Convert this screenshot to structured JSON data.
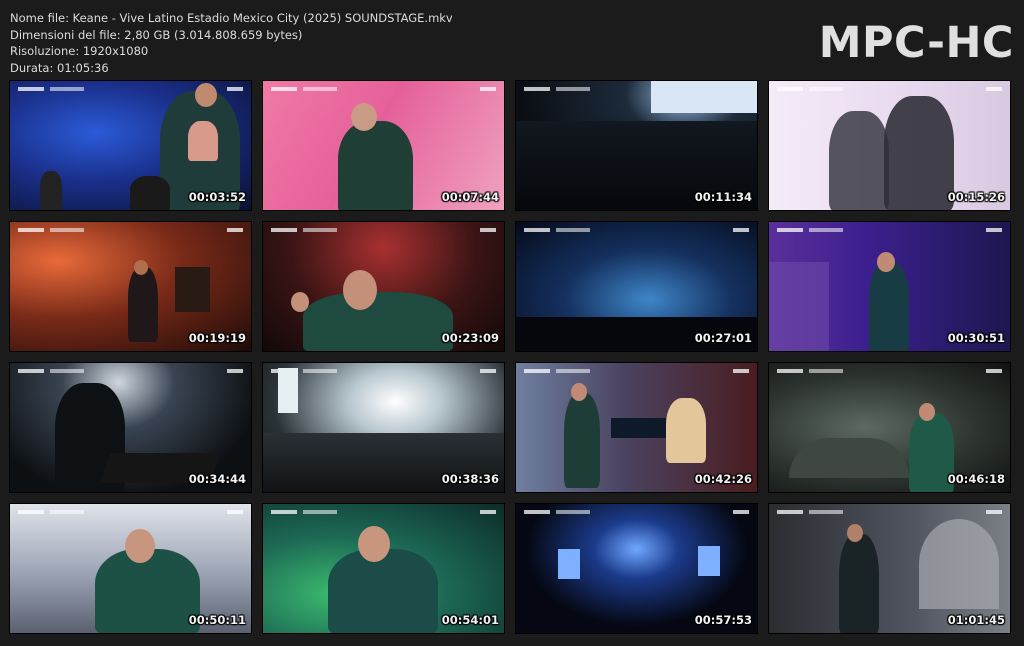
{
  "info": {
    "filename_line": "Nome file: Keane - Vive Latino Estadio Mexico City (2025) SOUNDSTAGE.mkv",
    "filesize_line": "Dimensioni del file: 2,80 GB (3.014.808.659 bytes)",
    "resolution_line": "Risoluzione: 1920x1080",
    "duration_line": "Durata: 01:05:36"
  },
  "logo": "MPC-HC",
  "thumbnails": [
    {
      "timestamp": "00:03:52"
    },
    {
      "timestamp": "00:07:44"
    },
    {
      "timestamp": "00:11:34"
    },
    {
      "timestamp": "00:15:26"
    },
    {
      "timestamp": "00:19:19"
    },
    {
      "timestamp": "00:23:09"
    },
    {
      "timestamp": "00:27:01"
    },
    {
      "timestamp": "00:30:51"
    },
    {
      "timestamp": "00:34:44"
    },
    {
      "timestamp": "00:38:36"
    },
    {
      "timestamp": "00:42:26"
    },
    {
      "timestamp": "00:46:18"
    },
    {
      "timestamp": "00:50:11"
    },
    {
      "timestamp": "00:54:01"
    },
    {
      "timestamp": "00:57:53"
    },
    {
      "timestamp": "01:01:45"
    }
  ]
}
